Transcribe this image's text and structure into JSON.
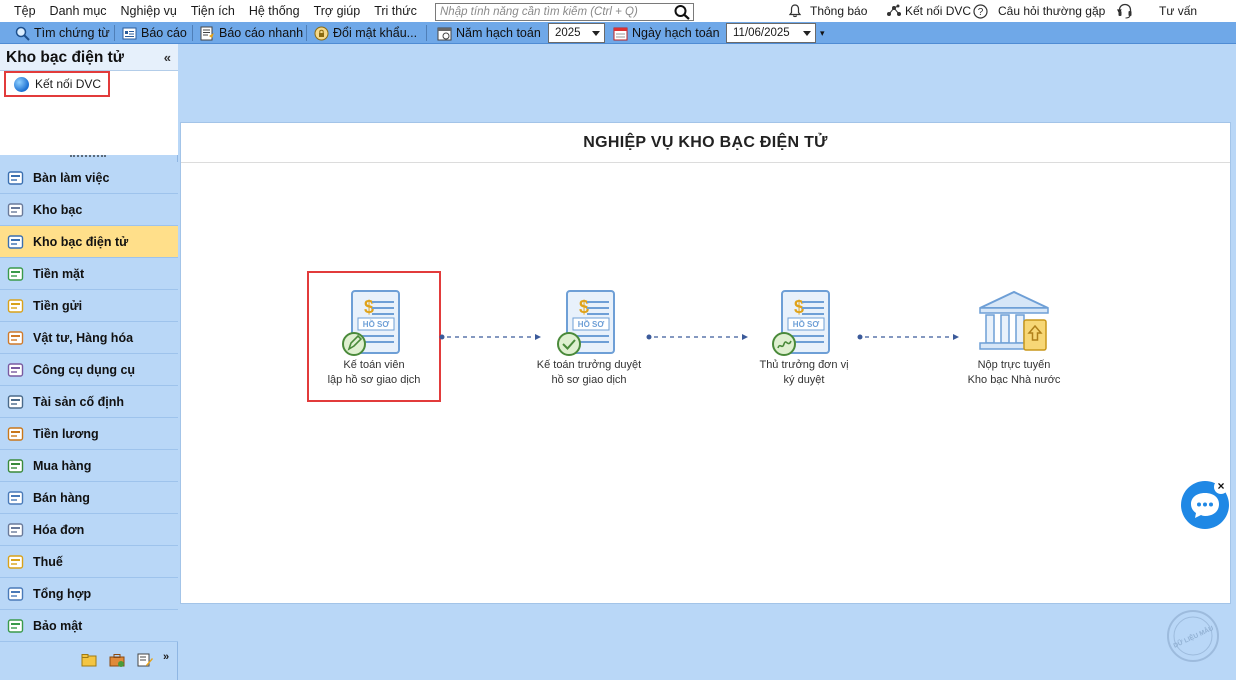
{
  "menu": {
    "items": [
      "Tệp",
      "Danh mục",
      "Nghiệp vụ",
      "Tiện ích",
      "Hệ thống",
      "Trợ giúp",
      "Tri thức"
    ],
    "search_placeholder": "Nhập tính năng cần tìm kiếm (Ctrl + Q)",
    "notification": "Thông báo",
    "connect_dvc": "Kết nối DVC",
    "faq": "Câu hỏi thường gặp",
    "consult": "Tư vấn"
  },
  "toolbar": {
    "find_voucher": "Tìm chứng từ",
    "report": "Báo cáo",
    "quick_report": "Báo cáo nhanh",
    "change_password": "Đổi mật khẩu...",
    "fiscal_year_label": "Năm hạch toán",
    "fiscal_year_value": "2025",
    "posting_date_label": "Ngày hạch toán",
    "posting_date_value": "11/06/2025"
  },
  "sidebar": {
    "title": "Kho bạc điện tử",
    "collapse": "«",
    "tree_item": "Kết nối DVC",
    "items": [
      {
        "label": "Bàn làm việc",
        "icon": "desk-icon",
        "active": false
      },
      {
        "label": "Kho bạc",
        "icon": "treasury-icon",
        "active": false
      },
      {
        "label": "Kho bạc điện tử",
        "icon": "e-treasury-icon",
        "active": true
      },
      {
        "label": "Tiền mặt",
        "icon": "cash-icon",
        "active": false
      },
      {
        "label": "Tiền gửi",
        "icon": "deposit-icon",
        "active": false
      },
      {
        "label": "Vật tư, Hàng hóa",
        "icon": "goods-icon",
        "active": false
      },
      {
        "label": "Công cụ dụng cụ",
        "icon": "tools-icon",
        "active": false
      },
      {
        "label": "Tài sản cố định",
        "icon": "fixed-assets-icon",
        "active": false
      },
      {
        "label": "Tiền lương",
        "icon": "salary-icon",
        "active": false
      },
      {
        "label": "Mua hàng",
        "icon": "cart-icon",
        "active": false
      },
      {
        "label": "Bán hàng",
        "icon": "sales-icon",
        "active": false
      },
      {
        "label": "Hóa đơn",
        "icon": "invoice-icon",
        "active": false
      },
      {
        "label": "Thuế",
        "icon": "tax-icon",
        "active": false
      },
      {
        "label": "Tổng hợp",
        "icon": "summary-icon",
        "active": false
      },
      {
        "label": "Bảo mật",
        "icon": "shield-icon",
        "active": false
      }
    ]
  },
  "main": {
    "title": "NGHIỆP VỤ KHO BẠC ĐIỆN TỬ",
    "steps": [
      {
        "line1": "Kế toán viên",
        "line2": "lập hồ sơ giao dịch",
        "icon": "document-edit-icon"
      },
      {
        "line1": "Kế toán trưởng duyệt",
        "line2": "hồ sơ giao dịch",
        "icon": "document-check-icon"
      },
      {
        "line1": "Thủ trưởng đơn vị",
        "line2": "ký duyệt",
        "icon": "document-sign-icon"
      },
      {
        "line1": "Nộp trực tuyến",
        "line2": "Kho bạc Nhà nước",
        "icon": "treasury-submit-icon"
      }
    ],
    "doc_badge": "HỒ SƠ"
  },
  "chat": {
    "close": "×"
  },
  "watermark": "DỮ LIỆU MẪU"
}
